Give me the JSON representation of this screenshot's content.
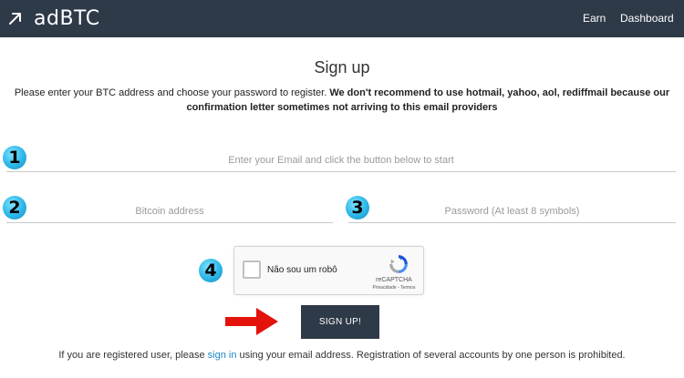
{
  "nav": {
    "brand": "adBTC",
    "brand_icon": "arrow-up-right-icon",
    "links": {
      "earn": "Earn",
      "dashboard": "Dashboard"
    },
    "background": "#2f3a48"
  },
  "page": {
    "title": "Sign up",
    "intro_plain": "Please enter your BTC address and choose your password to register.",
    "intro_bold": "We don't recommend to use hotmail, yahoo, aol, rediffmail because our confirmation letter sometimes not arriving to this email providers"
  },
  "steps": {
    "one": "1",
    "two": "2",
    "three": "3",
    "four": "4"
  },
  "form": {
    "email_placeholder": "Enter your Email and click the button below to start",
    "btc_placeholder": "Bitcoin address",
    "password_placeholder": "Password (At least 8 symbols)",
    "submit_label": "SIGN UP!"
  },
  "captcha": {
    "label": "Não sou um robô",
    "brand": "reCAPTCHA",
    "privacy": "Privacidade",
    "separator": " - ",
    "terms": "Termos"
  },
  "footer": {
    "before_link": "If you are registered user, please ",
    "link": "sign in",
    "after_link": " using your email address. Registration of several accounts by one person is prohibited."
  },
  "colors": {
    "accent_link": "#1e88c7",
    "step_badge": "#2bb6e8",
    "arrow": "#e3120b"
  }
}
